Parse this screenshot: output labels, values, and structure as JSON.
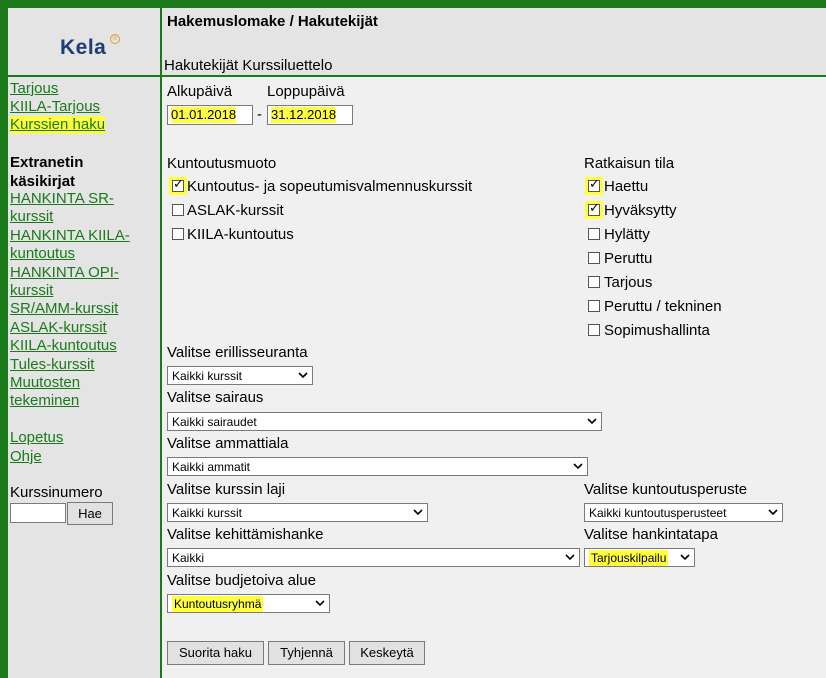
{
  "header": {
    "logo": "Kela",
    "logo_mark": "®",
    "title": "Hakemuslomake / Hakutekijät",
    "subtitle": "Hakutekijät Kurssiluettelo"
  },
  "sidebar": {
    "links_top": [
      "Tarjous",
      "KIILA-Tarjous",
      "Kurssien haku"
    ],
    "extranet_heading_1": "Extranetin",
    "extranet_heading_2": "käsikirjat",
    "links_mid": [
      [
        "HANKINTA  SR-",
        "kurssit"
      ],
      [
        "HANKINTA KIILA-",
        "kuntoutus"
      ],
      [
        "HANKINTA OPI-",
        "kurssit"
      ],
      [
        "SR/AMM-kurssit"
      ],
      [
        "ASLAK-kurssit"
      ],
      [
        "KIILA-kuntoutus"
      ],
      [
        "Tules-kurssit"
      ],
      [
        "Muutosten",
        "tekeminen"
      ]
    ],
    "links_bottom": [
      "Lopetus",
      "Ohje"
    ],
    "course_number_label": "Kurssinumero",
    "course_number_value": "",
    "search_button": "Hae"
  },
  "dates": {
    "start_label": "Alkupäivä",
    "end_label": "Loppupäivä",
    "start_value": "01.01.2018",
    "end_value": "31.12.2018",
    "separator": "-"
  },
  "rehab": {
    "heading": "Kuntoutusmuoto",
    "options": [
      {
        "label": "Kuntoutus- ja sopeutumisvalmennuskurssit",
        "checked": true
      },
      {
        "label": "ASLAK-kurssit",
        "checked": false
      },
      {
        "label": "KIILA-kuntoutus",
        "checked": false
      }
    ]
  },
  "decision": {
    "heading": "Ratkaisun tila",
    "options": [
      {
        "label": "Haettu",
        "checked": true
      },
      {
        "label": "Hyväksytty",
        "checked": true
      },
      {
        "label": "Hylätty",
        "checked": false
      },
      {
        "label": "Peruttu",
        "checked": false
      },
      {
        "label": "Tarjous",
        "checked": false
      },
      {
        "label": "Peruttu / tekninen",
        "checked": false
      },
      {
        "label": "Sopimushallinta",
        "checked": false
      }
    ]
  },
  "filters": {
    "followup_label": "Valitse erillisseuranta",
    "followup_value": "Kaikki kurssit",
    "disease_label": "Valitse sairaus",
    "disease_value": "Kaikki sairaudet",
    "profession_label": "Valitse ammattiala",
    "profession_value": "Kaikki ammatit",
    "course_type_label": "Valitse kurssin laji",
    "course_type_value": "Kaikki kurssit",
    "rehab_basis_label": "Valitse kuntoutusperuste",
    "rehab_basis_value": "Kaikki kuntoutusperusteet",
    "project_label": "Valitse kehittämishanke",
    "project_value": "Kaikki",
    "procurement_label": "Valitse hankintatapa",
    "procurement_value": "Tarjouskilpailu",
    "budget_label": "Valitse budjetoiva alue",
    "budget_value": "Kuntoutusryhmä"
  },
  "buttons": {
    "search": "Suorita haku",
    "clear": "Tyhjennä",
    "cancel": "Keskeytä"
  },
  "colors": {
    "frame_green": "#1a7a1a",
    "highlight_yellow": "#ffff40",
    "link_green": "#1a7a1a"
  }
}
